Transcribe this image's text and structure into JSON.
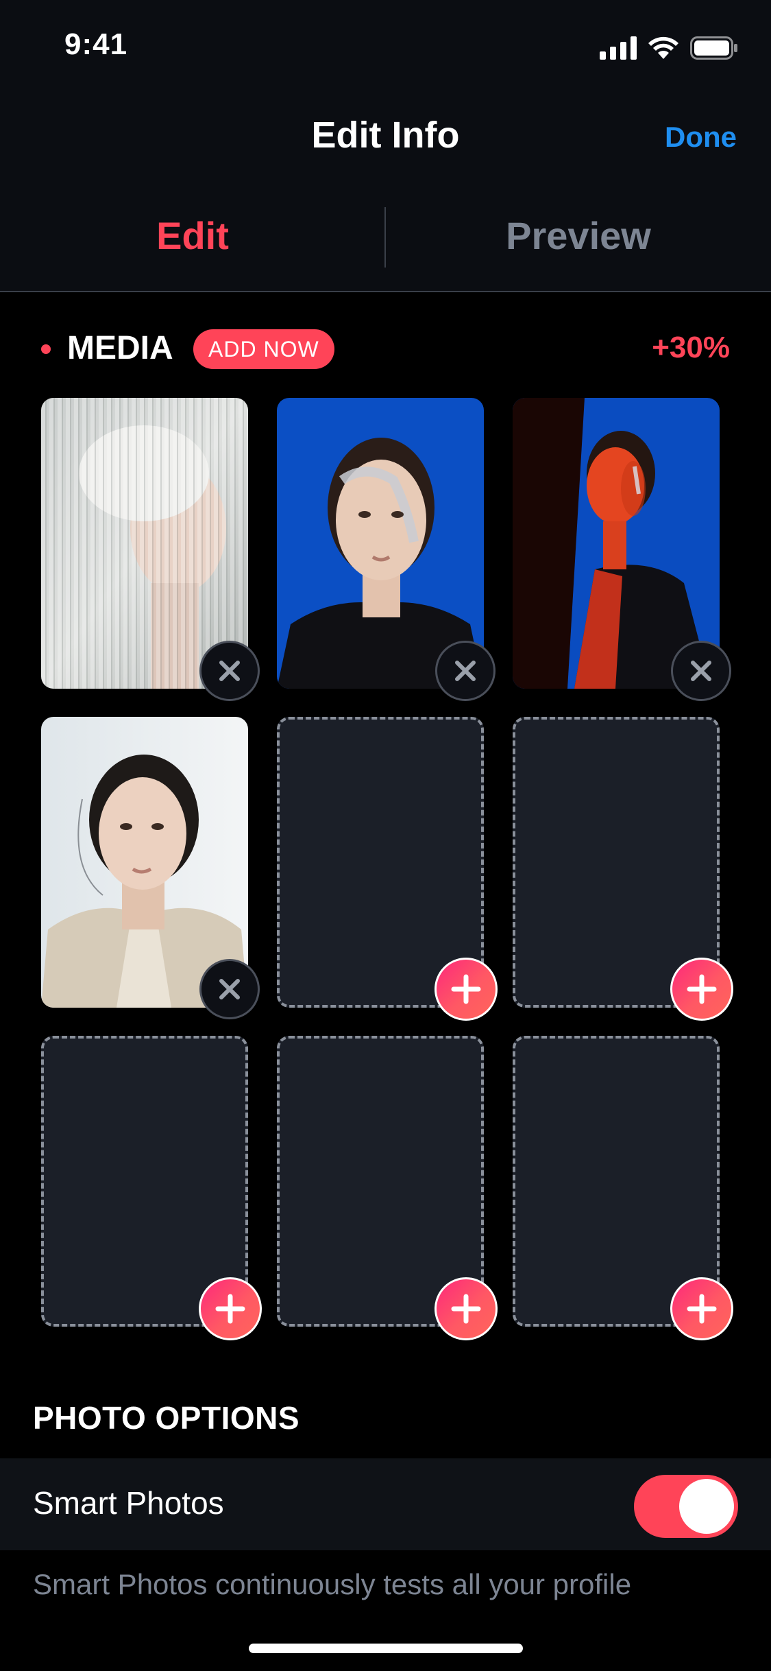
{
  "status_bar": {
    "time": "9:41",
    "icons": [
      "cellular-signal-icon",
      "wifi-icon",
      "battery-icon"
    ]
  },
  "nav": {
    "title": "Edit Info",
    "done_label": "Done"
  },
  "segments": {
    "edit_label": "Edit",
    "preview_label": "Preview",
    "selected": "Edit"
  },
  "media": {
    "title": "MEDIA",
    "add_now_label": "ADD NOW",
    "boost_label": "+30%",
    "slots": [
      {
        "filled": true,
        "photo": "portrait-behind-ribbed-glass"
      },
      {
        "filled": true,
        "photo": "portrait-blue-background-face-paint"
      },
      {
        "filled": true,
        "photo": "portrait-red-light-blue-background"
      },
      {
        "filled": true,
        "photo": "portrait-beige-coat-white-background"
      },
      {
        "filled": false
      },
      {
        "filled": false
      },
      {
        "filled": false
      },
      {
        "filled": false
      },
      {
        "filled": false
      }
    ]
  },
  "photo_options": {
    "section_title": "PHOTO OPTIONS",
    "smart_photos_label": "Smart Photos",
    "smart_photos_enabled": true,
    "description": "Smart Photos continuously tests all your profile"
  },
  "colors": {
    "accent": "#ff4458",
    "link": "#1f8ef0",
    "muted_text": "#7d8593",
    "background": "#000000"
  }
}
